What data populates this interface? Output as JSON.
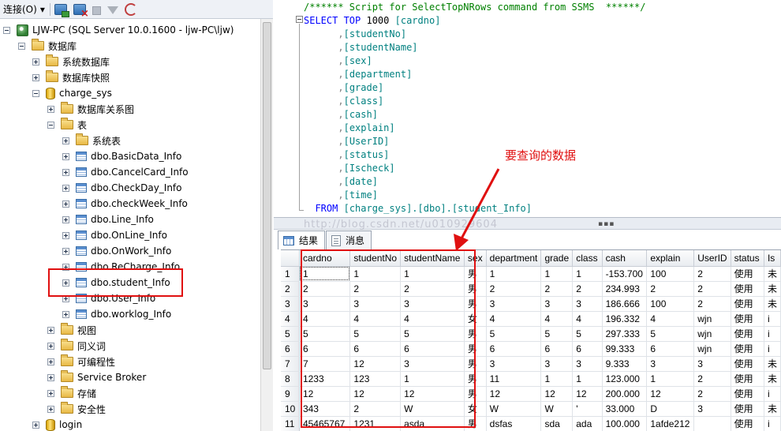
{
  "toolbar": {
    "connect_label": "连接(O)",
    "connect_dropdown": "▾",
    "icons": [
      "connect-object-explorer-icon",
      "disconnect-icon",
      "stop-icon",
      "filter-icon",
      "refresh-icon"
    ]
  },
  "tree": {
    "server": "LJW-PC (SQL Server 10.0.1600 - ljw-PC\\ljw)",
    "databases": "数据库",
    "system_databases": "系统数据库",
    "snapshots": "数据库快照",
    "db_name": "charge_sys",
    "diagrams": "数据库关系图",
    "tables": "表",
    "system_tables": "系统表",
    "table_items": [
      "dbo.BasicData_Info",
      "dbo.CancelCard_Info",
      "dbo.CheckDay_Info",
      "dbo.checkWeek_Info",
      "dbo.Line_Info",
      "dbo.OnLine_Info",
      "dbo.OnWork_Info",
      "dbo.ReCharge_Info",
      "dbo.student_Info",
      "dbo.User_Info",
      "dbo.worklog_Info"
    ],
    "views": "视图",
    "synonyms": "同义词",
    "programmability": "可编程性",
    "service_broker": "Service Broker",
    "storage": "存储",
    "security": "安全性",
    "login": "login"
  },
  "editor": {
    "comment": "/****** Script for SelectTopNRows command from SSMS  ******/",
    "select_kw": "SELECT TOP",
    "top_n": "1000",
    "first_col": "[cardno]",
    "columns": [
      "[studentNo]",
      "[studentName]",
      "[sex]",
      "[department]",
      "[grade]",
      "[class]",
      "[cash]",
      "[explain]",
      "[UserID]",
      "[status]",
      "[Ischeck]",
      "[date]",
      "[time]"
    ],
    "from_kw": "FROM",
    "from_target": "[charge_sys].[dbo].[student_Info]"
  },
  "watermark": "http://blog.csdn.net/u010929604",
  "tabs": {
    "results": "结果",
    "messages": "消息"
  },
  "annotation": "要查询的数据",
  "grid": {
    "columns": [
      "",
      "cardno",
      "studentNo",
      "studentName",
      "sex",
      "department",
      "grade",
      "class",
      "cash",
      "explain",
      "UserID",
      "status",
      "Is"
    ],
    "rows": [
      [
        "1",
        "1",
        "1",
        "1",
        "男",
        "1",
        "1",
        "1",
        "-153.700",
        "100",
        "2",
        "使用",
        "未"
      ],
      [
        "2",
        "2",
        "2",
        "2",
        "男",
        "2",
        "2",
        "2",
        "234.993",
        "2",
        "2",
        "使用",
        "未"
      ],
      [
        "3",
        "3",
        "3",
        "3",
        "男",
        "3",
        "3",
        "3",
        "186.666",
        "100",
        "2",
        "使用",
        "未"
      ],
      [
        "4",
        "4",
        "4",
        "4",
        "女",
        "4",
        "4",
        "4",
        "196.332",
        "4",
        "wjn",
        "使用",
        "i"
      ],
      [
        "5",
        "5",
        "5",
        "5",
        "男",
        "5",
        "5",
        "5",
        "297.333",
        "5",
        "wjn",
        "使用",
        "i"
      ],
      [
        "6",
        "6",
        "6",
        "6",
        "男",
        "6",
        "6",
        "6",
        "99.333",
        "6",
        "wjn",
        "使用",
        "i"
      ],
      [
        "7",
        "7",
        "12",
        "3",
        "男",
        "3",
        "3",
        "3",
        "9.333",
        "3",
        "3",
        "使用",
        "未"
      ],
      [
        "8",
        "1233",
        "123",
        "1",
        "男",
        "11",
        "1",
        "1",
        "123.000",
        "1",
        "2",
        "使用",
        "未"
      ],
      [
        "9",
        "12",
        "12",
        "12",
        "男",
        "12",
        "12",
        "12",
        "200.000",
        "12",
        "2",
        "使用",
        "i"
      ],
      [
        "10",
        "343",
        "2",
        "W",
        "女",
        "W",
        "W",
        "'",
        "33.000",
        "D",
        "3",
        "使用",
        "未"
      ],
      [
        "11",
        "45465767",
        "1231",
        "asda",
        "男",
        "dsfas",
        "sda",
        "ada",
        "100.000",
        "1afde212",
        "",
        "使用",
        "i"
      ]
    ]
  }
}
